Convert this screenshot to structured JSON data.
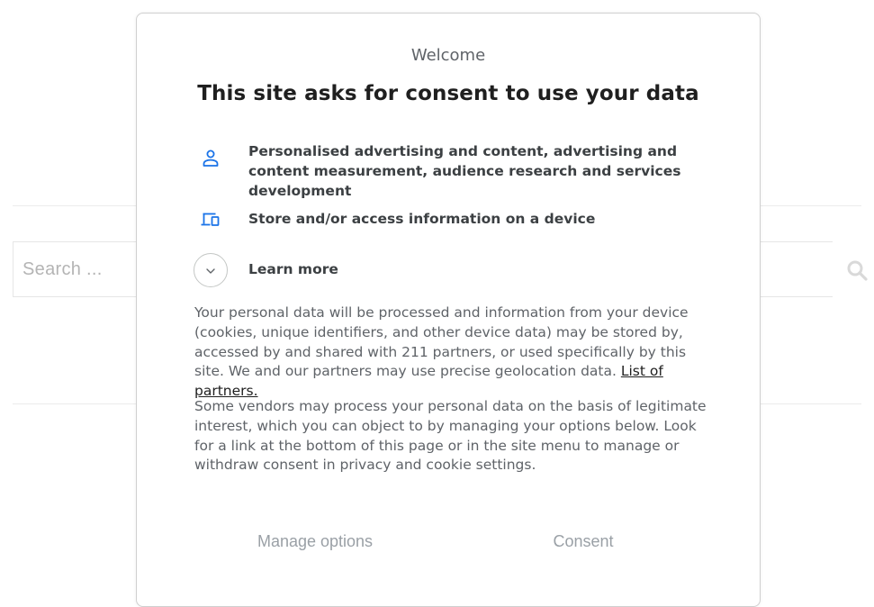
{
  "background": {
    "search_placeholder": "Search ..."
  },
  "dialog": {
    "welcome": "Welcome",
    "title": "This site asks for consent to use your data",
    "purposes": [
      {
        "icon": "person-icon",
        "text": "Personalised advertising and content, advertising and content measurement, audience research and services development"
      },
      {
        "icon": "devices-icon",
        "text": "Store and/or access information on a device"
      }
    ],
    "learn_more": "Learn more",
    "paragraph1": "Your personal data will be processed and information from your device (cookies, unique identifiers, and other device data) may be stored by, accessed by and shared with 211 partners, or used specifically by this site. We and our partners may use precise geolocation data.",
    "partners_link": "List of partners.",
    "paragraph2": "Some vendors may process your personal data on the basis of legitimate interest, which you can object to by managing your options below. Look for a link at the bottom of this page or in the site menu to manage or withdraw consent in privacy and cookie settings.",
    "manage_options": "Manage options",
    "consent": "Consent"
  },
  "colors": {
    "accent": "#1a73e8",
    "text_dark": "#1f1f1f",
    "text_body": "#5f6368",
    "button_text": "#9aa0a6"
  }
}
